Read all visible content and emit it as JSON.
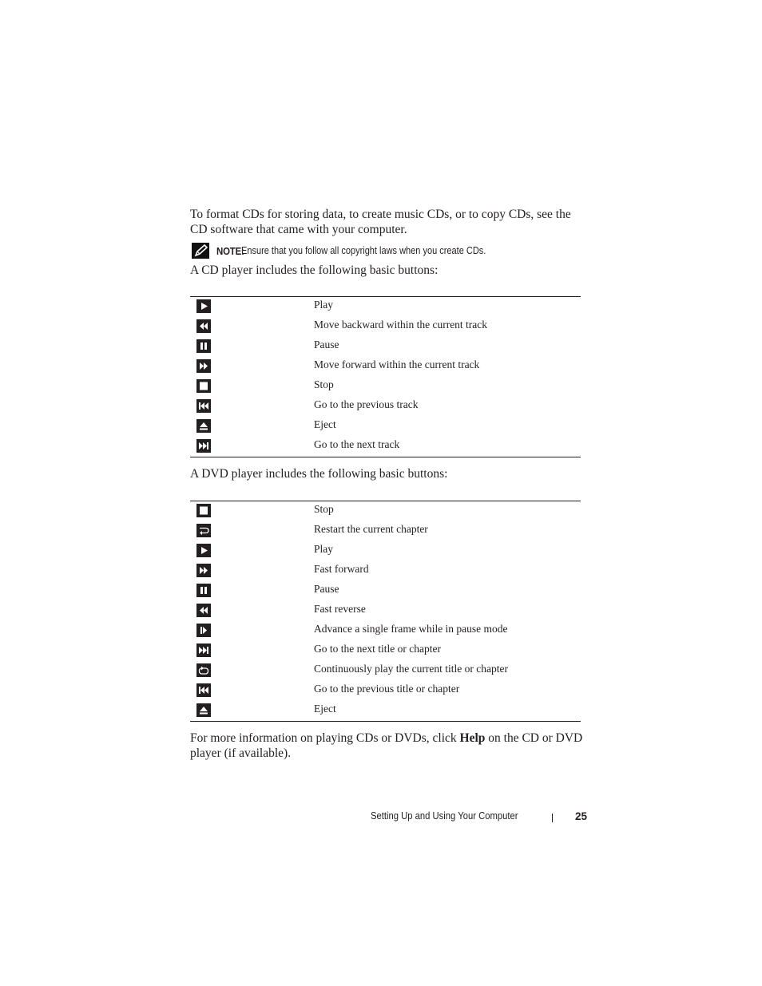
{
  "intro_paragraph": "To format CDs for storing data, to create music CDs, or to copy CDs, see the CD software that came with your computer.",
  "note": {
    "icon": "pencil-note-icon",
    "label": "NOTE:",
    "text": "Ensure that you follow all copyright laws when you create CDs."
  },
  "cd_intro": "A CD player includes the following basic buttons:",
  "cd_buttons": [
    {
      "icon": "play-icon",
      "label": "Play"
    },
    {
      "icon": "rewind-icon",
      "label": "Move backward within the current track"
    },
    {
      "icon": "pause-icon",
      "label": "Pause"
    },
    {
      "icon": "fast-forward-icon",
      "label": "Move forward within the current track"
    },
    {
      "icon": "stop-icon",
      "label": "Stop"
    },
    {
      "icon": "previous-track-icon",
      "label": "Go to the previous track"
    },
    {
      "icon": "eject-icon",
      "label": "Eject"
    },
    {
      "icon": "next-track-icon",
      "label": "Go to the next track"
    }
  ],
  "dvd_intro": "A DVD player includes the following basic buttons:",
  "dvd_buttons": [
    {
      "icon": "stop-icon",
      "label": "Stop"
    },
    {
      "icon": "restart-chapter-icon",
      "label": "Restart the current chapter"
    },
    {
      "icon": "play-icon",
      "label": "Play"
    },
    {
      "icon": "fast-forward-icon",
      "label": "Fast forward"
    },
    {
      "icon": "pause-icon",
      "label": "Pause"
    },
    {
      "icon": "rewind-icon",
      "label": "Fast reverse"
    },
    {
      "icon": "frame-advance-icon",
      "label": "Advance a single frame while in pause mode"
    },
    {
      "icon": "next-track-icon",
      "label": "Go to the next title or chapter"
    },
    {
      "icon": "repeat-icon",
      "label": "Continuously play the current title or chapter"
    },
    {
      "icon": "previous-track-icon",
      "label": "Go to the previous title or chapter"
    },
    {
      "icon": "eject-icon",
      "label": "Eject"
    }
  ],
  "more_info": {
    "before": "For more information on playing CDs or DVDs, click ",
    "bold": "Help",
    "after": " on the CD or DVD player (if available)."
  },
  "footer": {
    "section_title": "Setting Up and Using Your Computer",
    "page_number": "25"
  }
}
